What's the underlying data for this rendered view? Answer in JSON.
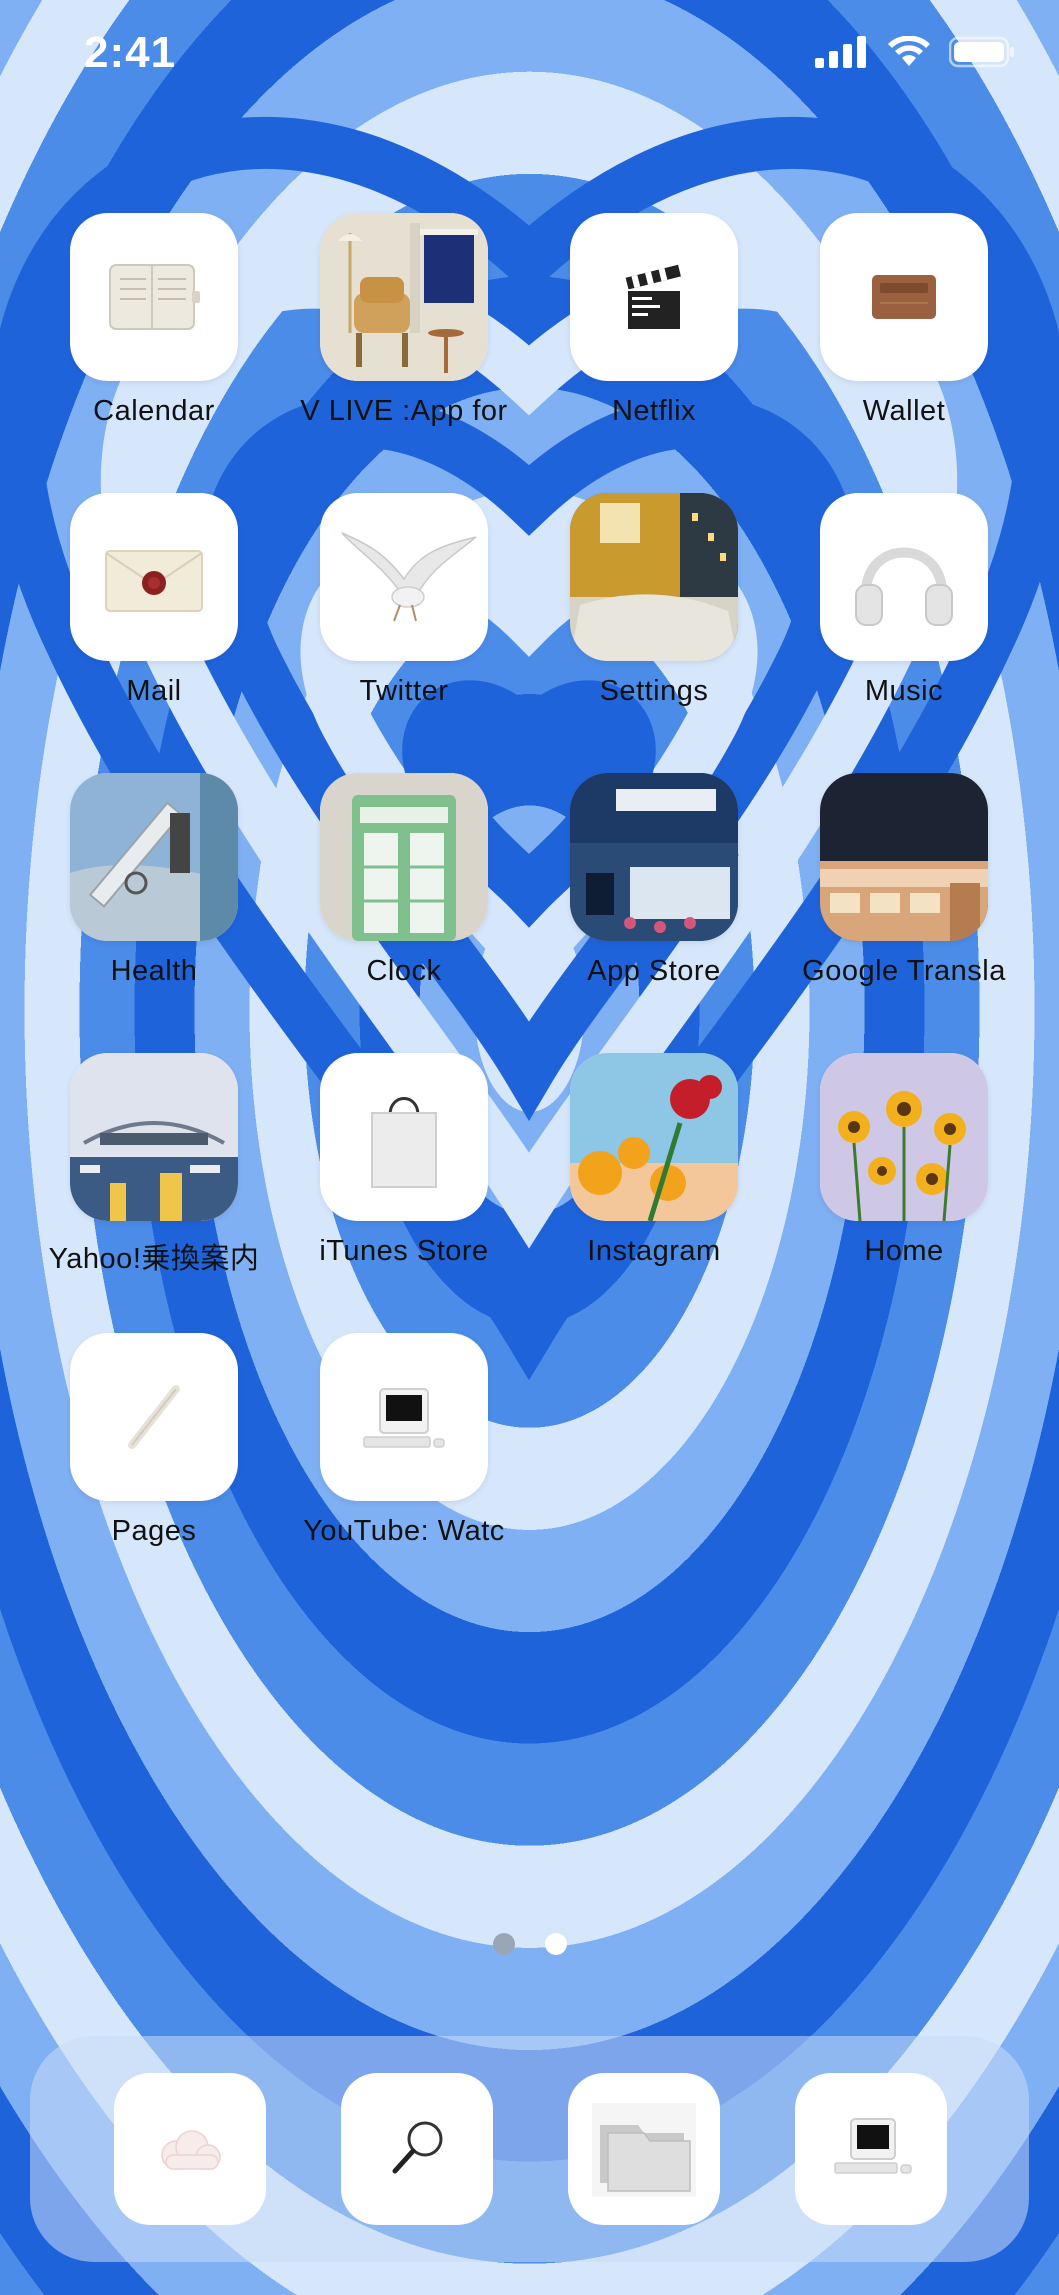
{
  "status_bar": {
    "time": "2:41",
    "icons": [
      "cellular-signal-icon",
      "wifi-icon",
      "battery-icon"
    ]
  },
  "apps": [
    {
      "label": "Calendar",
      "icon": "planner-icon"
    },
    {
      "label": "V LIVE :App for",
      "icon": "armchair-room-icon"
    },
    {
      "label": "Netflix",
      "icon": "clapperboard-icon"
    },
    {
      "label": "Wallet",
      "icon": "card-holder-icon"
    },
    {
      "label": "Mail",
      "icon": "sealed-envelope-icon"
    },
    {
      "label": "Twitter",
      "icon": "dove-icon"
    },
    {
      "label": "Settings",
      "icon": "bedroom-photo-icon"
    },
    {
      "label": "Music",
      "icon": "headphones-icon"
    },
    {
      "label": "Health",
      "icon": "telescope-photo-icon"
    },
    {
      "label": "Clock",
      "icon": "phone-booth-icon"
    },
    {
      "label": "App Store",
      "icon": "storefront-photo-icon"
    },
    {
      "label": "Google Transla",
      "icon": "diner-photo-icon"
    },
    {
      "label": "Yahoo!乗換案内",
      "icon": "stadium-photo-icon"
    },
    {
      "label": "iTunes Store",
      "icon": "shopping-bag-icon"
    },
    {
      "label": "Instagram",
      "icon": "flowers-sky-icon"
    },
    {
      "label": "Home",
      "icon": "sunflowers-icon"
    },
    {
      "label": "Pages",
      "icon": "pen-icon"
    },
    {
      "label": "YouTube: Watc",
      "icon": "retro-computer-icon"
    }
  ],
  "page_indicator": {
    "pages": 2,
    "current": 2
  },
  "dock": [
    {
      "icon": "cloud-icon"
    },
    {
      "icon": "magnifier-icon"
    },
    {
      "icon": "folders-icon"
    },
    {
      "icon": "retro-computer-icon"
    }
  ],
  "colors": {
    "wallpaper_light": "#d6e6fb",
    "wallpaper_mid": "#7fb0f3",
    "wallpaper_dark": "#1f63db",
    "label": "#111111",
    "dot_inactive": "#9aa6b8",
    "dot_active": "#ffffff"
  }
}
